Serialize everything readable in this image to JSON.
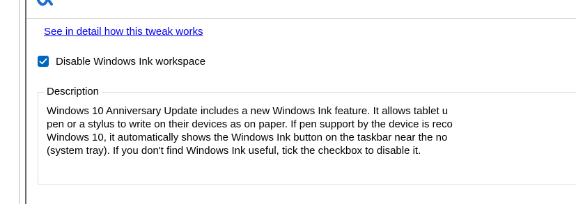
{
  "link": {
    "text": "See in detail how this tweak works"
  },
  "option": {
    "label": "Disable Windows Ink workspace",
    "checked": true
  },
  "description": {
    "title": "Description",
    "lines": [
      "Windows 10 Anniversary Update includes a new Windows Ink feature. It allows tablet u",
      "pen or a stylus to write on their devices as on paper. If pen support by the device is reco",
      "Windows 10, it automatically shows the Windows Ink button on the taskbar near the no",
      "(system tray). If you don't find Windows Ink useful, tick the checkbox to disable it."
    ]
  },
  "colors": {
    "link": "#0000ee",
    "checkbox": "#0067c0",
    "logo": "#1f6fd1"
  },
  "icons": {
    "logo_fragment": "tweaker-logo-icon",
    "checkbox_mark": "checkmark-icon"
  }
}
